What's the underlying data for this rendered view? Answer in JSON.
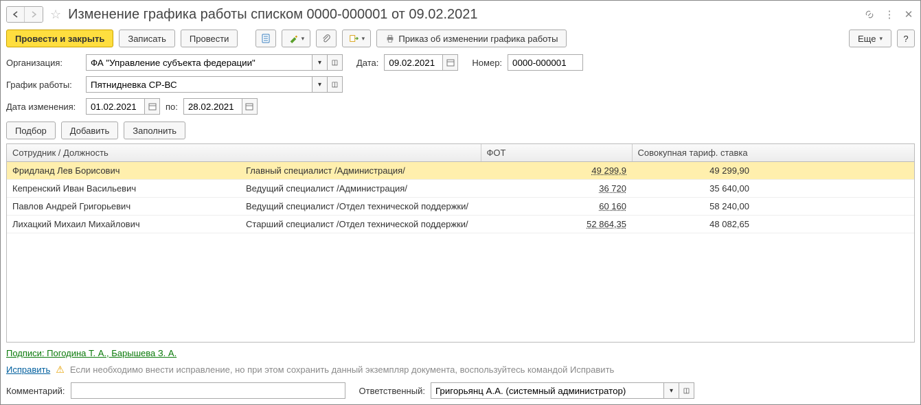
{
  "title": "Изменение графика работы списком 0000-000001 от 09.02.2021",
  "toolbar": {
    "post_close": "Провести и закрыть",
    "save": "Записать",
    "post": "Провести",
    "print_order": "Приказ об изменении графика работы",
    "more": "Еще"
  },
  "form": {
    "org_label": "Организация:",
    "org_value": "ФА \"Управление субъекта федерации\"",
    "date_label": "Дата:",
    "date_value": "09.02.2021",
    "number_label": "Номер:",
    "number_value": "0000-000001",
    "schedule_label": "График работы:",
    "schedule_value": "Пятнидневка СР-ВС",
    "change_date_label": "Дата изменения:",
    "change_from": "01.02.2021",
    "to_label": "по:",
    "change_to": "28.02.2021"
  },
  "actions": {
    "select": "Подбор",
    "add": "Добавить",
    "fill": "Заполнить"
  },
  "table": {
    "headers": {
      "employee": "Сотрудник / Должность",
      "fot": "ФОТ",
      "rate": "Совокупная тариф. ставка"
    },
    "rows": [
      {
        "name": "Фридланд Лев Борисович",
        "pos": "Главный специалист /Администрация/",
        "fot": "49 299,9",
        "rate": "49 299,90"
      },
      {
        "name": "Кепренский Иван Васильевич",
        "pos": "Ведущий специалист /Администрация/",
        "fot": "36 720",
        "rate": "35 640,00"
      },
      {
        "name": "Павлов Андрей Григорьевич",
        "pos": "Ведущий специалист /Отдел технической поддержки/",
        "fot": "60 160",
        "rate": "58 240,00"
      },
      {
        "name": "Лихацкий Михаил Михайлович",
        "pos": "Старший специалист /Отдел технической поддержки/",
        "fot": "52 864,35",
        "rate": "48 082,65"
      }
    ]
  },
  "signatures_label": "Подписи: Погодина Т. А., Барышева З. А.",
  "correct_link": "Исправить",
  "correct_hint": "Если необходимо внести исправление, но при этом сохранить данный экземпляр документа, воспользуйтесь командой Исправить",
  "comment_label": "Комментарий:",
  "responsible_label": "Ответственный:",
  "responsible_value": "Григорьянц А.А. (системный администратор)"
}
